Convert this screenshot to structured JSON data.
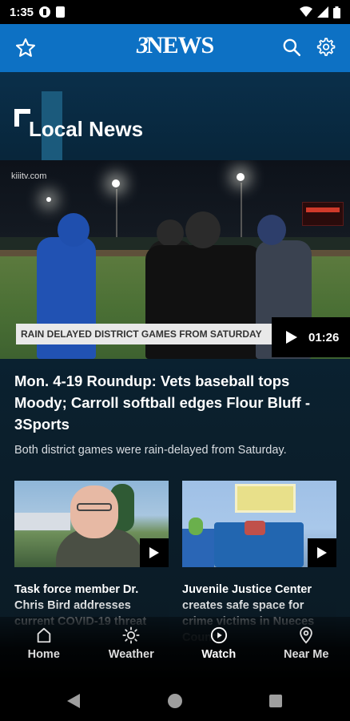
{
  "status_bar": {
    "time": "1:35"
  },
  "app_bar": {
    "brand_prefix": "3",
    "brand_word": "NEWS",
    "favorites_icon": "star-icon",
    "search_icon": "search-icon",
    "settings_icon": "gear-icon"
  },
  "section": {
    "title": "Local News"
  },
  "hero": {
    "watermark": "kiiitv.com",
    "lower_third": "RAIN DELAYED DISTRICT GAMES FROM SATURDAY",
    "duration": "01:26",
    "headline": "Mon. 4-19 Roundup: Vets baseball tops Moody; Carroll softball edges Flour Bluff - 3Sports",
    "summary": "Both district games were rain-delayed from Saturday."
  },
  "cards": [
    {
      "title": "Task force member Dr. Chris Bird addresses current COVID-19 threat"
    },
    {
      "title": "Juvenile Justice Center creates safe space for crime victims in Nueces County"
    }
  ],
  "bottom_nav": [
    {
      "label": "Home",
      "icon": "home-icon"
    },
    {
      "label": "Weather",
      "icon": "sun-icon"
    },
    {
      "label": "Watch",
      "icon": "play-circle-icon",
      "active": true
    },
    {
      "label": "Near Me",
      "icon": "location-pin-icon"
    }
  ],
  "colors": {
    "app_bar": "#0d71c4",
    "background": "#0b1f2c"
  }
}
